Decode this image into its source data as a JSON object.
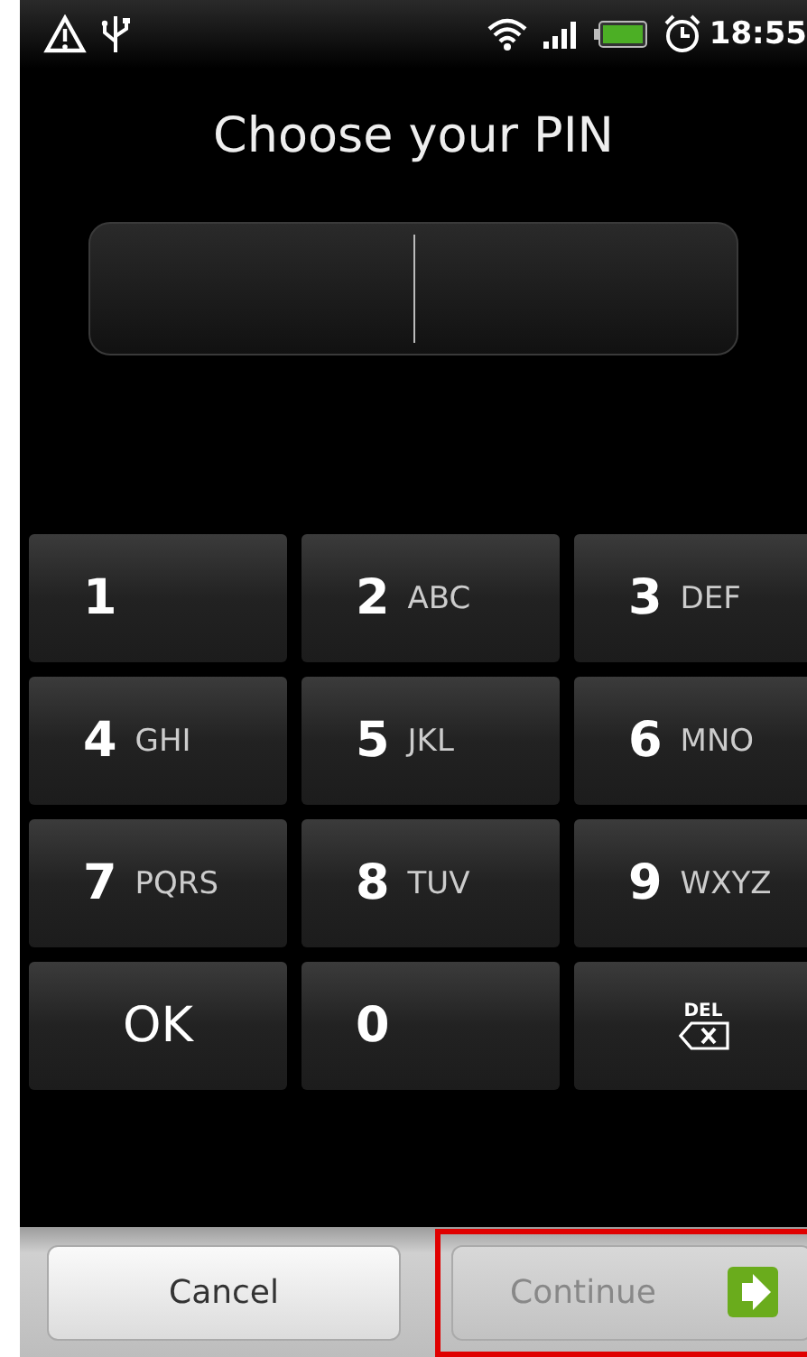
{
  "status_bar": {
    "time": "18:55"
  },
  "title": "Choose your PIN",
  "pin_field": {
    "focused": true
  },
  "keys": [
    {
      "kind": "digit",
      "digit": "1"
    },
    {
      "kind": "digit",
      "digit": "2",
      "letters": "ABC"
    },
    {
      "kind": "digit",
      "digit": "3",
      "letters": "DEF"
    },
    {
      "kind": "digit",
      "digit": "4",
      "letters": "GHI"
    },
    {
      "kind": "digit",
      "digit": "5",
      "letters": "JKL"
    },
    {
      "kind": "digit",
      "digit": "6",
      "letters": "MNO"
    },
    {
      "kind": "digit",
      "digit": "7",
      "letters": "PQRS"
    },
    {
      "kind": "digit",
      "digit": "8",
      "letters": "TUV"
    },
    {
      "kind": "digit",
      "digit": "9",
      "letters": "WXYZ"
    },
    {
      "kind": "ok",
      "label": "OK"
    },
    {
      "kind": "digit",
      "digit": "0"
    },
    {
      "kind": "delete",
      "label": "DEL"
    }
  ],
  "buttons": [
    {
      "label": "Cancel",
      "disabled": false
    },
    {
      "label": "Continue",
      "disabled": true,
      "highlighted": true
    }
  ]
}
